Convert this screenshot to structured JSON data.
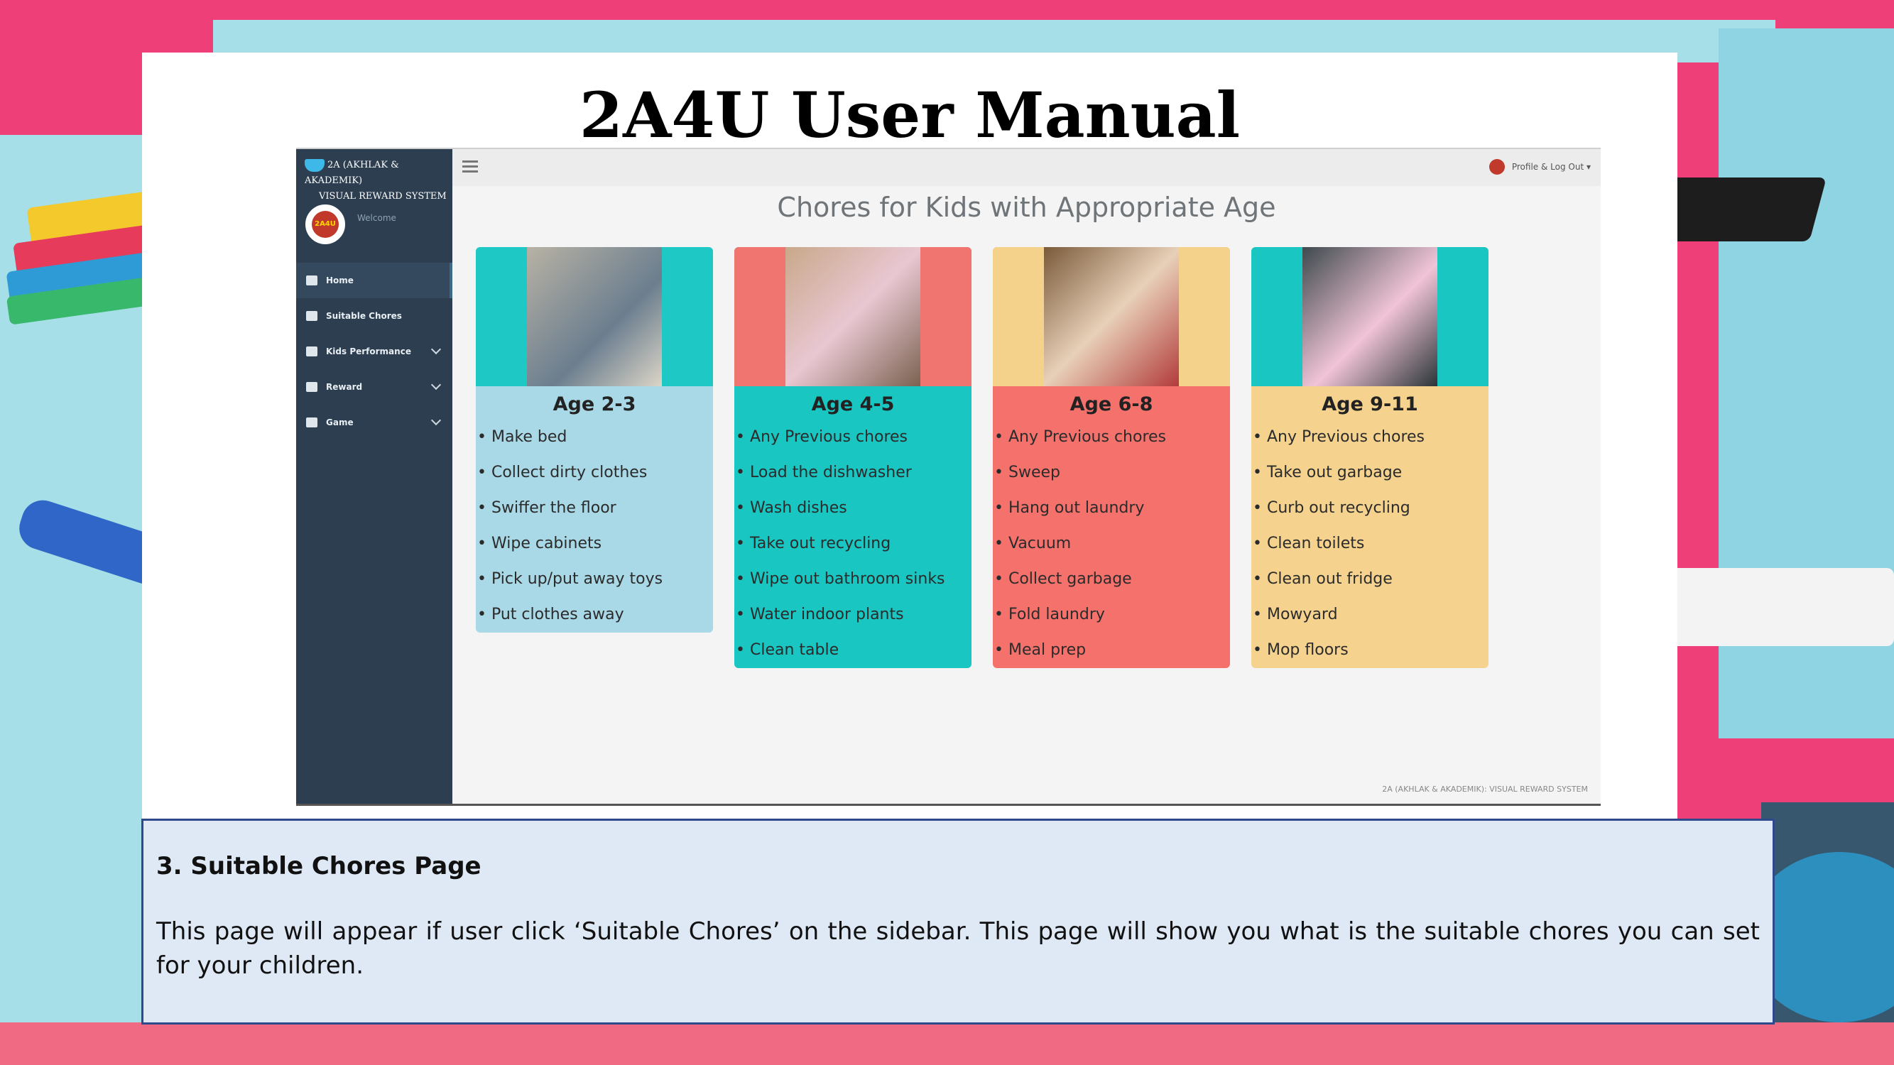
{
  "slide": {
    "title": "2A4U User Manual"
  },
  "app": {
    "brand_line1": "2A (AKHLAK & AKADEMIK)",
    "brand_line2": "VISUAL REWARD SYSTEM",
    "avatar_text": "2A4U",
    "welcome": "Welcome",
    "profile_label": "Profile & Log Out ▾",
    "page_heading": "Chores for Kids with Appropriate Age",
    "footer": "2A (AKHLAK & AKADEMIK): VISUAL REWARD SYSTEM",
    "nav": [
      {
        "label": "Home",
        "icon": "home-icon",
        "active": true
      },
      {
        "label": "Suitable Chores",
        "icon": "document-icon"
      },
      {
        "label": "Kids Performance",
        "icon": "calendar-icon",
        "dropdown": true
      },
      {
        "label": "Reward",
        "icon": "gift-icon",
        "dropdown": true
      },
      {
        "label": "Game",
        "icon": "gamepad-icon",
        "dropdown": true
      }
    ],
    "cards": [
      {
        "age": "Age 2-3",
        "bg": "#a9d8e6",
        "photo_bg": "#1ec8c4",
        "items": [
          "Make bed",
          "Collect dirty clothes",
          "Swiffer the floor",
          "Wipe cabinets",
          "Pick up/put away toys",
          "Put clothes away"
        ]
      },
      {
        "age": "Age 4-5",
        "bg": "#19c6c2",
        "photo_bg": "#f07470",
        "items": [
          "Any Previous chores",
          "Load the dishwasher",
          "Wash dishes",
          "Take out recycling",
          "Wipe out bathroom sinks",
          "Water indoor plants",
          "Clean table"
        ]
      },
      {
        "age": "Age 6-8",
        "bg": "#f5716c",
        "photo_bg": "#f5d28c",
        "items": [
          "Any Previous chores",
          "Sweep",
          "Hang out laundry",
          "Vacuum",
          "Collect garbage",
          "Fold laundry",
          "Meal prep"
        ]
      },
      {
        "age": "Age 9-11",
        "bg": "#f5d38f",
        "photo_bg": "#19c6c2",
        "items": [
          "Any Previous chores",
          "Take out garbage",
          "Curb out recycling",
          "Clean toilets",
          "Clean out fridge",
          "Mowyard",
          "Mop floors"
        ]
      }
    ]
  },
  "description": {
    "heading": "3. Suitable Chores Page",
    "body": "This page will appear if user click ‘Suitable Chores’ on the sidebar. This page will show you what is the suitable chores you can set for your children."
  }
}
